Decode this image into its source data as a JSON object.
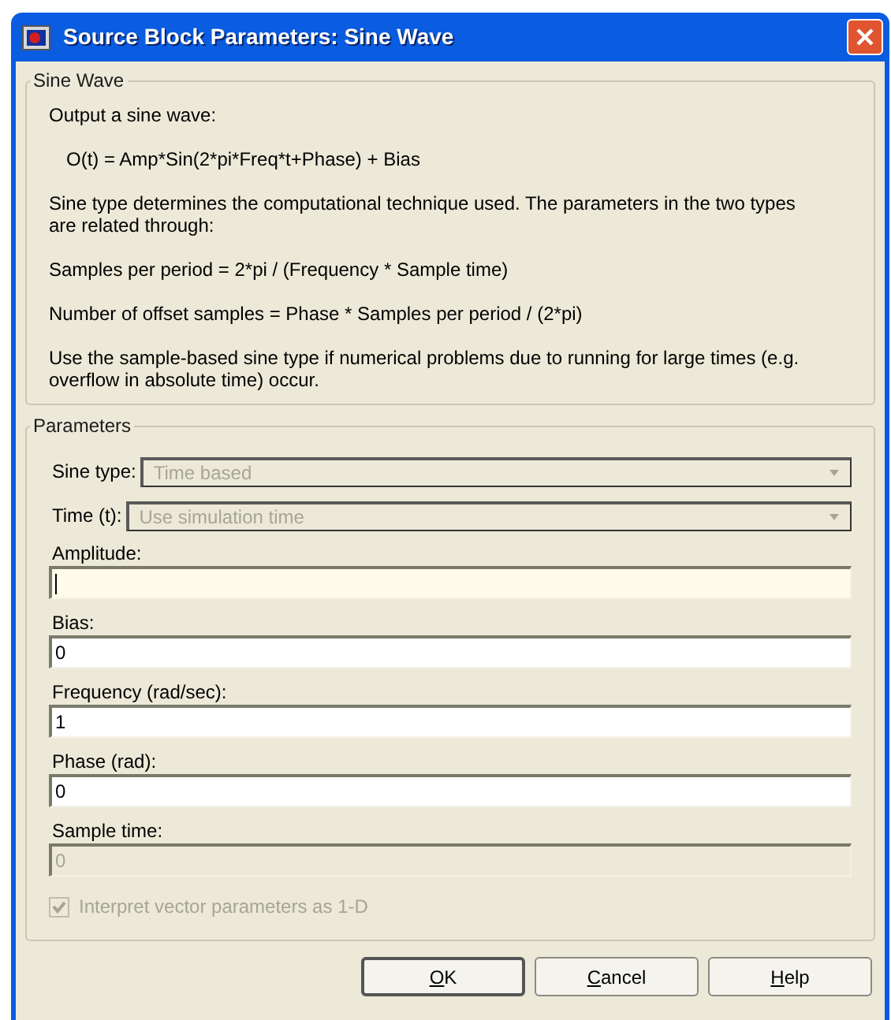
{
  "window": {
    "title": "Source Block Parameters: Sine Wave"
  },
  "description": {
    "title": "Sine Wave",
    "paragraphs": [
      {
        "text": "Output a sine wave:",
        "indent": false
      },
      {
        "text": "O(t) = Amp*Sin(2*pi*Freq*t+Phase) + Bias",
        "indent": true
      },
      {
        "text": "Sine type determines the computational technique used. The parameters in the two types are related through:",
        "indent": false
      },
      {
        "text": "Samples per period = 2*pi / (Frequency * Sample time)",
        "indent": false
      },
      {
        "text": "Number of offset samples = Phase * Samples per period / (2*pi)",
        "indent": false
      },
      {
        "text": "Use the sample-based sine type if numerical problems due to running for large times (e.g. overflow in absolute time) occur.",
        "indent": false
      }
    ]
  },
  "parameters": {
    "title": "Parameters",
    "fields": [
      {
        "kind": "dropdown",
        "label": "Sine type:",
        "value": "Time based",
        "disabled": true
      },
      {
        "kind": "dropdown",
        "label": "Time (t):",
        "value": "Use simulation time",
        "disabled": true
      },
      {
        "kind": "text",
        "label": "Amplitude:",
        "focused": true,
        "disabled": false
      },
      {
        "kind": "text",
        "label": "Bias:",
        "value": "0",
        "focused": false,
        "disabled": false
      },
      {
        "kind": "text",
        "label": "Frequency (rad/sec):",
        "value": "1",
        "focused": false,
        "disabled": false
      },
      {
        "kind": "text",
        "label": "Phase (rad):",
        "value": "0",
        "focused": false,
        "disabled": false
      },
      {
        "kind": "text",
        "label": "Sample time:",
        "value": "0",
        "focused": false,
        "disabled": true
      },
      {
        "kind": "checkbox",
        "label": "Interpret vector parameters as 1-D",
        "checked": true,
        "disabled": true
      }
    ]
  },
  "buttons": [
    {
      "label": "OK",
      "underline_first": true,
      "default": true
    },
    {
      "label": "Cancel",
      "underline_first": true,
      "default": false
    },
    {
      "label": "Help",
      "underline_first": true,
      "default": false
    }
  ]
}
